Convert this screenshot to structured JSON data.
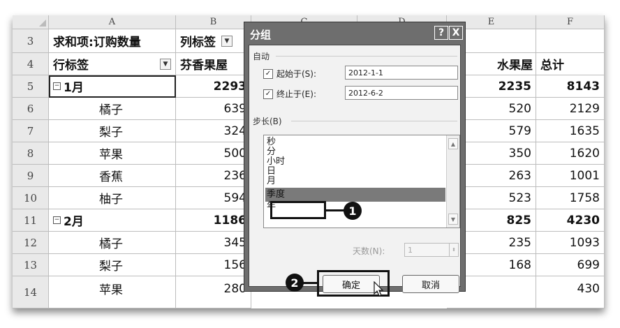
{
  "sheet": {
    "columns": [
      "A",
      "B",
      "C",
      "D",
      "E",
      "F"
    ],
    "row_numbers": [
      "3",
      "4",
      "5",
      "6",
      "7",
      "8",
      "9",
      "10",
      "11",
      "12",
      "13",
      "14"
    ],
    "row3": {
      "a": "求和项:订购数量",
      "b": "列标签"
    },
    "row4": {
      "a": "行标签",
      "b": "芬香果屋",
      "e": "水果屋",
      "f": "总计"
    },
    "groups": [
      {
        "label": "1月",
        "b": "2293",
        "e": "2235",
        "f": "8143"
      },
      {
        "label": "2月",
        "b": "1186",
        "e": "825",
        "f": "4230"
      }
    ],
    "items": [
      {
        "name": "橘子",
        "b": "639",
        "e": "520",
        "f": "2129"
      },
      {
        "name": "梨子",
        "b": "324",
        "e": "579",
        "f": "1635"
      },
      {
        "name": "苹果",
        "b": "500",
        "e": "350",
        "f": "1620"
      },
      {
        "name": "香蕉",
        "b": "236",
        "e": "263",
        "f": "1001"
      },
      {
        "name": "柚子",
        "b": "594",
        "e": "523",
        "f": "1758"
      },
      {
        "name": "橘子",
        "b": "345",
        "e": "235",
        "f": "1093"
      },
      {
        "name": "梨子",
        "b": "156",
        "e": "168",
        "f": "699"
      },
      {
        "name": "苹果",
        "b": "280",
        "e": "",
        "f": "430"
      }
    ]
  },
  "dialog": {
    "title": "分组",
    "help": "?",
    "close": "X",
    "auto_section": "自动",
    "start_label": "起始于(S):",
    "start_value": "2012-1-1",
    "end_label": "终止于(E):",
    "end_value": "2012-6-2",
    "step_section": "步长(B)",
    "step_items": [
      "秒",
      "分",
      "小时",
      "日",
      "月",
      "季度",
      "年"
    ],
    "days_label": "天数(N):",
    "days_value": "1",
    "ok": "确定",
    "cancel": "取消",
    "check": "✓"
  },
  "callouts": {
    "one": "1",
    "two": "2"
  }
}
